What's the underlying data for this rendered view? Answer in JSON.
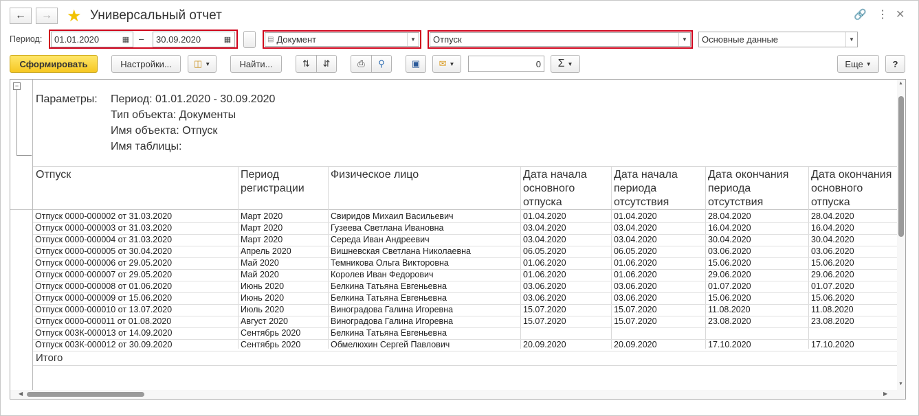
{
  "window": {
    "title": "Универсальный отчет"
  },
  "period": {
    "label": "Период:",
    "from": "01.01.2020",
    "to": "30.09.2020",
    "dash": "–"
  },
  "selectors": {
    "object_type": "Документ",
    "object_name": "Отпуск",
    "data_set": "Основные данные"
  },
  "toolbar": {
    "generate": "Сформировать",
    "settings": "Настройки...",
    "find": "Найти...",
    "counter_value": "0",
    "sigma": "Σ",
    "more": "Еще",
    "help": "?"
  },
  "report": {
    "params_label": "Параметры:",
    "params": [
      "Период: 01.01.2020 - 30.09.2020",
      "Тип объекта: Документы",
      "Имя объекта: Отпуск",
      "Имя таблицы:"
    ],
    "columns": [
      "Отпуск",
      "Период регистрации",
      "Физическое лицо",
      "Дата начала основного отпуска",
      "Дата начала периода отсутствия",
      "Дата окончания периода отсутствия",
      "Дата окончания основного отпуска"
    ],
    "rows": [
      [
        "Отпуск 0000-000002 от 31.03.2020",
        "Март 2020",
        "Свиридов Михаил Васильевич",
        "01.04.2020",
        "01.04.2020",
        "28.04.2020",
        "28.04.2020"
      ],
      [
        "Отпуск 0000-000003 от 31.03.2020",
        "Март 2020",
        "Гузеева Светлана Ивановна",
        "03.04.2020",
        "03.04.2020",
        "16.04.2020",
        "16.04.2020"
      ],
      [
        "Отпуск 0000-000004 от 31.03.2020",
        "Март 2020",
        "Середа Иван Андреевич",
        "03.04.2020",
        "03.04.2020",
        "30.04.2020",
        "30.04.2020"
      ],
      [
        "Отпуск 0000-000005 от 30.04.2020",
        "Апрель 2020",
        "Вишневская Светлана Николаевна",
        "06.05.2020",
        "06.05.2020",
        "03.06.2020",
        "03.06.2020"
      ],
      [
        "Отпуск 0000-000006 от 29.05.2020",
        "Май 2020",
        "Темникова Ольга Викторовна",
        "01.06.2020",
        "01.06.2020",
        "15.06.2020",
        "15.06.2020"
      ],
      [
        "Отпуск 0000-000007 от 29.05.2020",
        "Май 2020",
        "Королев Иван Федорович",
        "01.06.2020",
        "01.06.2020",
        "29.06.2020",
        "29.06.2020"
      ],
      [
        "Отпуск 0000-000008 от 01.06.2020",
        "Июнь 2020",
        "Белкина Татьяна Евгеньевна",
        "03.06.2020",
        "03.06.2020",
        "01.07.2020",
        "01.07.2020"
      ],
      [
        "Отпуск 0000-000009 от 15.06.2020",
        "Июнь 2020",
        "Белкина Татьяна Евгеньевна",
        "03.06.2020",
        "03.06.2020",
        "15.06.2020",
        "15.06.2020"
      ],
      [
        "Отпуск 0000-000010 от 13.07.2020",
        "Июль 2020",
        "Виноградова Галина Игоревна",
        "15.07.2020",
        "15.07.2020",
        "11.08.2020",
        "11.08.2020"
      ],
      [
        "Отпуск 0000-000011 от 01.08.2020",
        "Август 2020",
        "Виноградова Галина Игоревна",
        "15.07.2020",
        "15.07.2020",
        "23.08.2020",
        "23.08.2020"
      ],
      [
        "Отпуск 003К-000013 от 14.09.2020",
        "Сентябрь 2020",
        "Белкина Татьяна Евгеньевна",
        "",
        "",
        "",
        ""
      ],
      [
        "Отпуск 003К-000012 от 30.09.2020",
        "Сентябрь 2020",
        "Обмелюхин Сергей Павлович",
        "20.09.2020",
        "20.09.2020",
        "17.10.2020",
        "17.10.2020"
      ]
    ],
    "total_label": "Итого"
  },
  "colors": {
    "highlight": "#d0021b",
    "primary_button": "#f6c722",
    "star": "#f2c200"
  },
  "icons": [
    "back-arrow-icon",
    "forward-arrow-icon",
    "star-icon",
    "link-icon",
    "more-vert-icon",
    "close-icon",
    "calendar-icon",
    "document-icon",
    "variants-icon",
    "sort-asc-icon",
    "sort-desc-icon",
    "print-icon",
    "preview-icon",
    "save-icon",
    "mail-icon",
    "sigma-icon",
    "collapse-icon"
  ]
}
